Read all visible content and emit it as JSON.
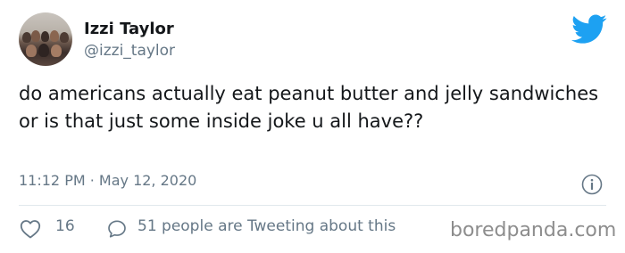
{
  "user": {
    "name": "Izzi Taylor",
    "handle": "@izzi_taylor"
  },
  "tweet": {
    "text": "do americans actually eat peanut butter and jelly sandwiches or is that just some inside joke u all have??",
    "timestamp": "11:12 PM · May 12, 2020"
  },
  "actions": {
    "like_count": "16",
    "tweeting_text": "51 people are Tweeting about this"
  },
  "watermark": "boredpanda.com",
  "icons": {
    "brand": "twitter-bird-icon",
    "info": "info-icon",
    "like": "heart-icon",
    "reply": "speech-bubble-icon"
  },
  "colors": {
    "twitter_blue": "#1da1f2",
    "secondary_text": "#657786",
    "divider": "#e1e8ed",
    "watermark": "#8d8d8d"
  }
}
